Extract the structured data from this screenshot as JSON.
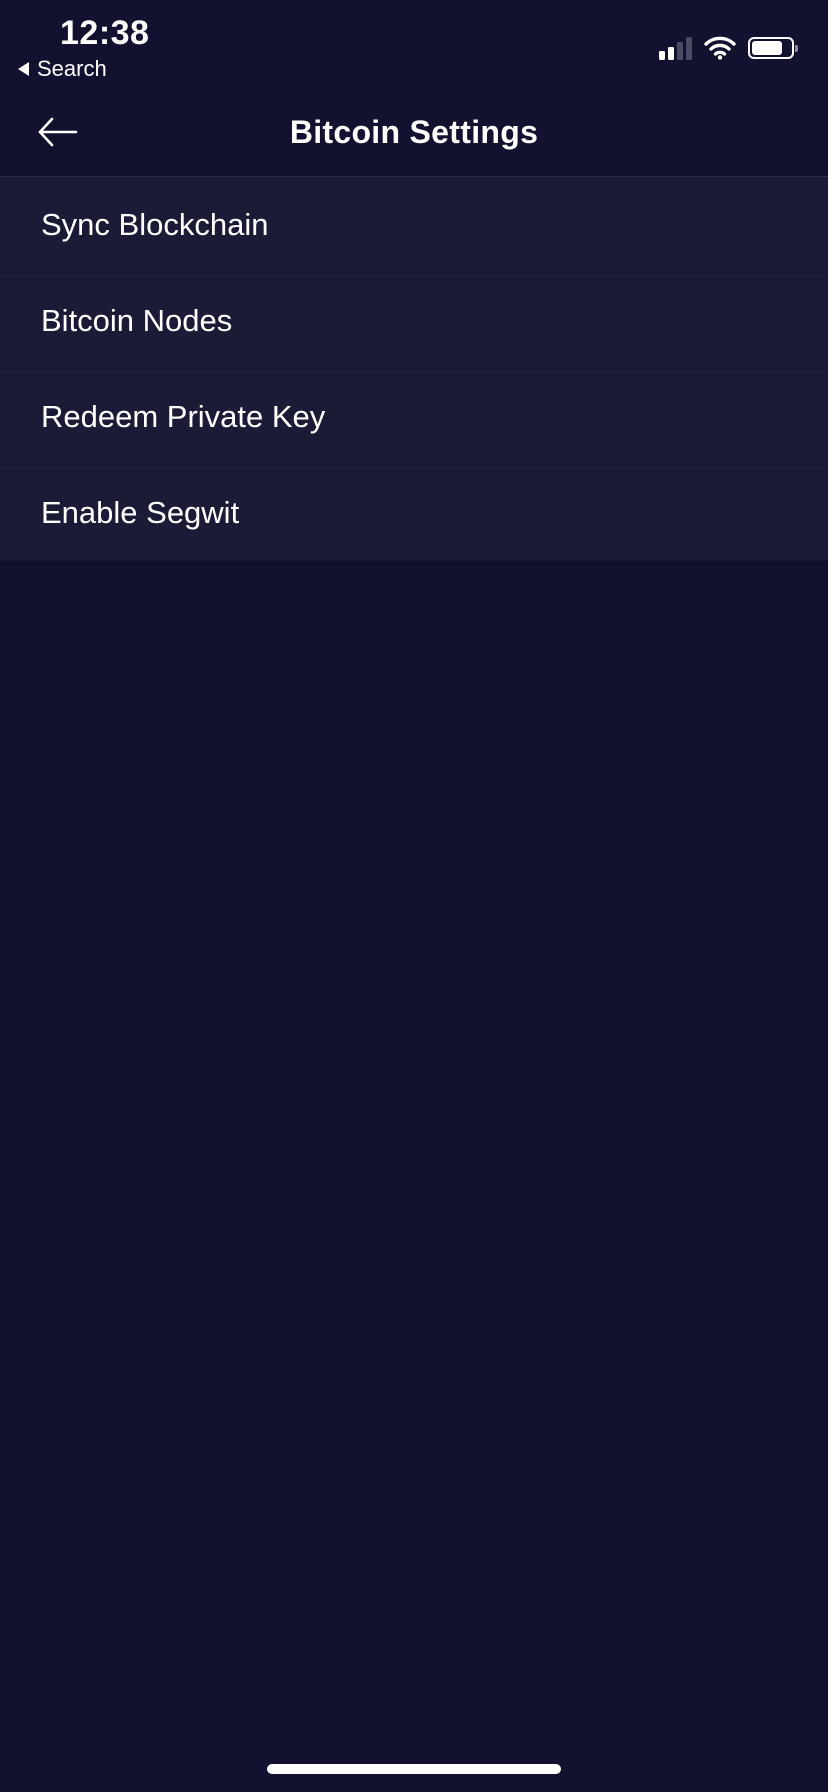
{
  "status_bar": {
    "time": "12:38",
    "back_app_label": "Search",
    "signal_icon": "cellular-signal-icon",
    "wifi_icon": "wifi-icon",
    "battery_icon": "battery-icon",
    "battery_level": 0.8
  },
  "header": {
    "back_icon": "arrow-left-icon",
    "title": "Bitcoin Settings"
  },
  "settings": {
    "items": [
      {
        "label": "Sync Blockchain"
      },
      {
        "label": "Bitcoin Nodes"
      },
      {
        "label": "Redeem Private Key"
      },
      {
        "label": "Enable Segwit"
      }
    ]
  },
  "colors": {
    "background": "#121230",
    "list_item_background": "#1b1b38",
    "text": "#ffffff"
  }
}
